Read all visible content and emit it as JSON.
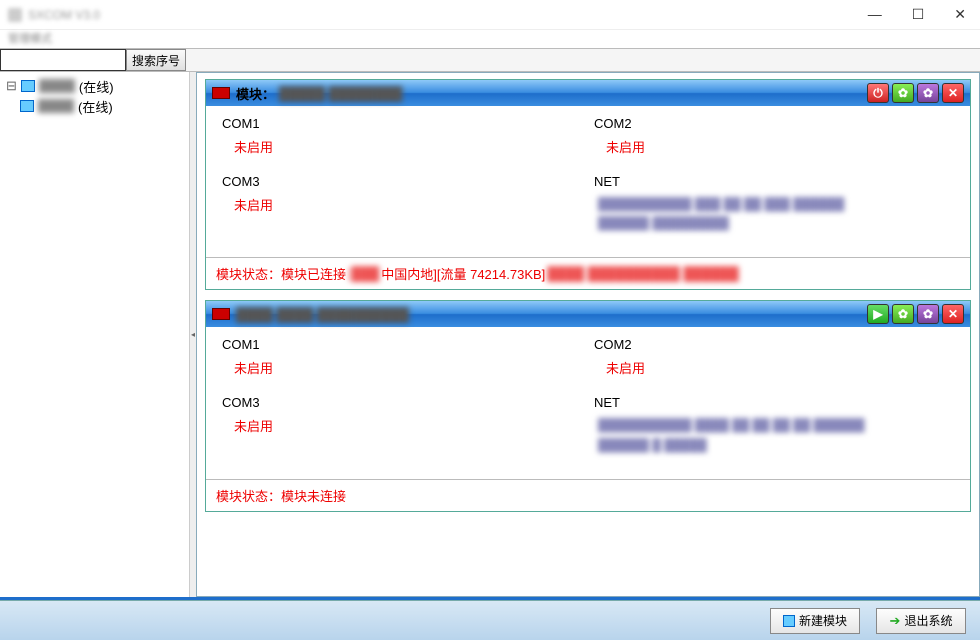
{
  "window": {
    "title": "SXCOM V3.0",
    "subtitle": "管理模式"
  },
  "search": {
    "button": "搜索序号"
  },
  "sidebar": {
    "items": [
      {
        "status": "(在线)"
      },
      {
        "status": "(在线)"
      }
    ]
  },
  "panels": [
    {
      "title_prefix": "模块：",
      "header_btns": [
        "power",
        "gear",
        "gear2",
        "close"
      ],
      "ports": {
        "com1": {
          "label": "COM1",
          "status": "未启用"
        },
        "com2": {
          "label": "COM2",
          "status": "未启用"
        },
        "com3": {
          "label": "COM3",
          "status": "未启用"
        },
        "net": {
          "label": "NET",
          "info_lines": 2
        }
      },
      "footer": {
        "prefix": "模块状态：模块已连接",
        "mid": " 中国内地][流量 74214.73KB]"
      }
    },
    {
      "title_prefix": "",
      "header_btns": [
        "play",
        "gear",
        "gear2",
        "close"
      ],
      "ports": {
        "com1": {
          "label": "COM1",
          "status": "未启用"
        },
        "com2": {
          "label": "COM2",
          "status": "未启用"
        },
        "com3": {
          "label": "COM3",
          "status": "未启用"
        },
        "net": {
          "label": "NET",
          "info_lines": 2
        }
      },
      "footer": {
        "prefix": "模块状态：模块未连接",
        "mid": ""
      }
    }
  ],
  "bottom": {
    "new_module": "新建模块",
    "exit": "退出系统"
  }
}
